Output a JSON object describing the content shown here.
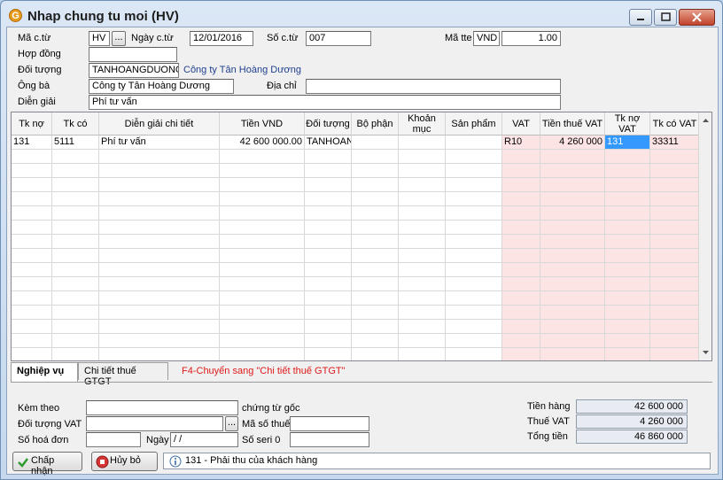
{
  "window": {
    "title": "Nhap chung tu moi (HV)",
    "icon_label": "G"
  },
  "header": {
    "ma_ctu_label": "Mã c.từ",
    "ma_ctu_value": "HV",
    "ma_ctu_btn": "...",
    "ngay_ctu_label": "Ngày c.từ",
    "ngay_ctu_value": "12/01/2016",
    "so_ctu_label": "Số c.từ",
    "so_ctu_value": "007",
    "ma_tte_label": "Mã tte",
    "ma_tte_value": "VND",
    "ty_gia_value": "1.00",
    "hop_dong_label": "Hợp đồng",
    "hop_dong_value": "",
    "doi_tuong_label": "Đối tượng",
    "doi_tuong_code": "TANHOANGDUONG",
    "doi_tuong_name": "Công ty Tân Hoàng Dương",
    "ong_ba_label": "Ông bà",
    "ong_ba_value": "Công ty Tân Hoàng Dương",
    "dia_chi_label": "Địa chỉ",
    "dia_chi_value": "",
    "dien_giai_label": "Diễn giải",
    "dien_giai_value": "Phí tư vấn"
  },
  "grid": {
    "columns": [
      "Tk nợ",
      "Tk có",
      "Diễn giải chi tiết",
      "Tiền VND",
      "Đối tượng",
      "Bộ phận",
      "Khoản mục",
      "Sản phẩm",
      "VAT",
      "Tiền thuế VAT",
      "Tk nợ VAT",
      "Tk có VAT"
    ],
    "rows": [
      [
        "131",
        "5111",
        "Phí tư vấn",
        "42 600 000.00",
        "TANHOANG",
        "",
        "",
        "",
        "R10",
        "4 260 000",
        "131",
        "33311"
      ]
    ]
  },
  "tabs": {
    "nghiep_vu": "Nghiệp vụ",
    "chi_tiet": "Chi tiết thuế GTGT",
    "hint": "F4-Chuyển sang \"Chi tiết thuế GTGT\""
  },
  "footer": {
    "kem_theo_label": "Kèm theo",
    "kem_theo_value": "",
    "chung_tu_goc": "chứng từ gốc",
    "doi_tuong_vat_label": "Đối tượng VAT",
    "doi_tuong_vat_value": "",
    "doi_tuong_vat_btn": "...",
    "ma_so_thue_label": "Mã số thuế",
    "ma_so_thue_value": "",
    "so_hoa_don_label": "Số hoá đơn",
    "so_hoa_don_value": "",
    "ngay_label": "Ngày",
    "ngay_value": "/ /",
    "so_seri_label": "Số seri 0",
    "so_seri_value": "",
    "tien_hang_label": "Tiền hàng",
    "tien_hang_value": "42 600 000",
    "thue_vat_label": "Thuế VAT",
    "thue_vat_value": "4 260 000",
    "tong_tien_label": "Tổng tiền",
    "tong_tien_value": "46 860 000",
    "chap_nhan": "Chấp nhận",
    "huy_bo": "Hủy bỏ",
    "status_text": "131 - Phải thu của khách hàng"
  }
}
